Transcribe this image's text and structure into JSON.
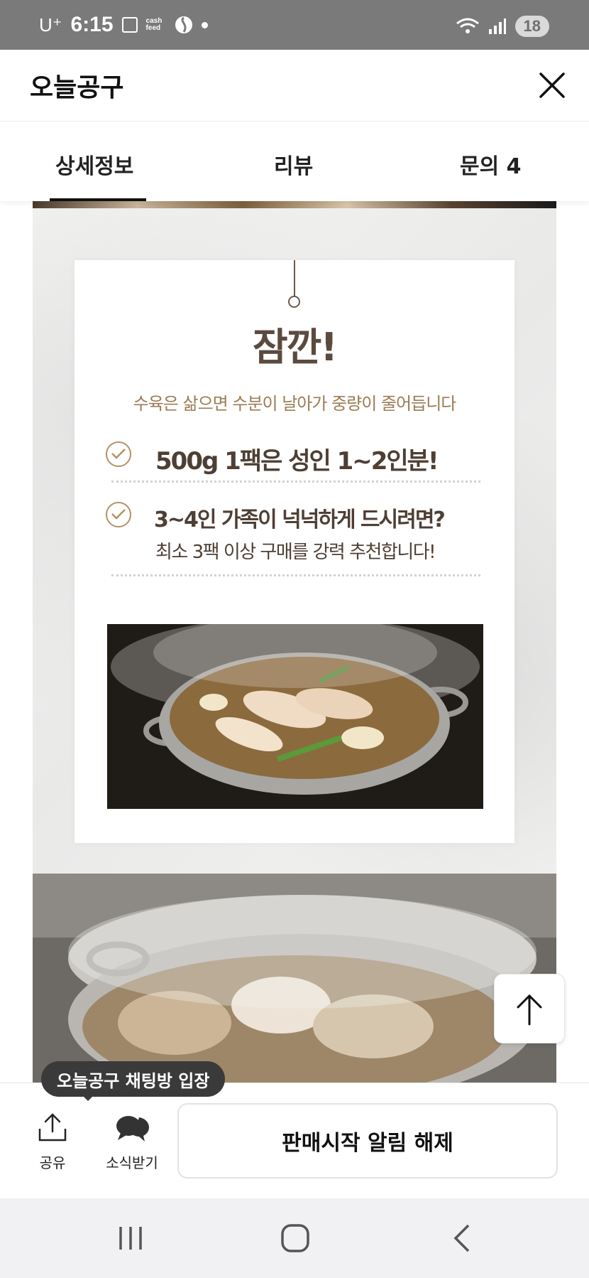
{
  "status_bar": {
    "carrier": "U⁺",
    "time": "6:15",
    "cash_text": "cash feed",
    "battery": "18"
  },
  "app_bar": {
    "title": "오늘공구"
  },
  "tabs": [
    {
      "label": "상세정보",
      "active": true
    },
    {
      "label": "리뷰",
      "active": false
    },
    {
      "label": "문의 4",
      "active": false
    }
  ],
  "notice_card": {
    "title": "잠깐!",
    "subtitle": "수육은 삶으면 수분이 날아가 중량이 줄어듭니다",
    "point1": "500g 1팩은 성인 1~2인분!",
    "point2": "3~4인 가족이 넉넉하게 드시려면?",
    "point2_sub": "최소 3팩 이상 구매를 강력 추천합니다!"
  },
  "bottom_bar": {
    "tooltip": "오늘공구 채팅방 입장",
    "share_label": "공유",
    "news_label": "소식받기",
    "notify_button": "판매시작 알림 해제"
  },
  "colors": {
    "accent_brown": "#5b4a3f",
    "sub_gold": "#9c7b54",
    "check_gold": "#b59164"
  }
}
